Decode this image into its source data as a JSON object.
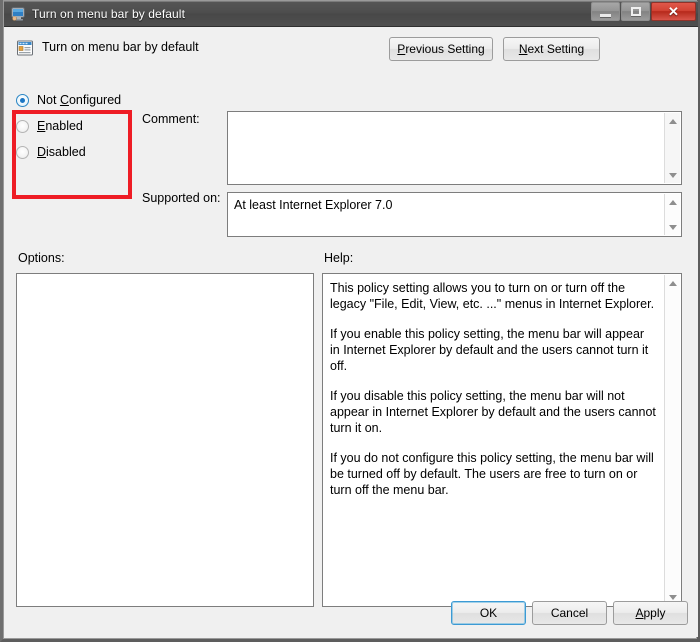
{
  "window": {
    "title": "Turn on menu bar by default",
    "icon": "computer-monitor-icon",
    "controls": {
      "minimize": "minimize-icon",
      "maximize": "maximize-icon",
      "close": "✕"
    }
  },
  "header": {
    "policy_icon": "policy-setting-icon",
    "policy_title": "Turn on menu bar by default",
    "previous_button": {
      "pre": "",
      "acc": "P",
      "post": "revious Setting"
    },
    "next_button": {
      "pre": "",
      "acc": "N",
      "post": "ext Setting"
    }
  },
  "states": {
    "options": [
      {
        "label_pre": "Not ",
        "label_acc": "C",
        "label_post": "onfigured",
        "selected": true
      },
      {
        "label_pre": "",
        "label_acc": "E",
        "label_post": "nabled",
        "selected": false
      },
      {
        "label_pre": "",
        "label_acc": "D",
        "label_post": "isabled",
        "selected": false
      }
    ]
  },
  "annotation": {
    "type": "red-rectangle-highlight",
    "color": "#ee1c25",
    "targets": "state-radio-group"
  },
  "fields": {
    "comment_label": "Comment:",
    "comment_value": "",
    "comment_placeholder": "",
    "supported_label": "Supported on:",
    "supported_value": "At least Internet Explorer 7.0"
  },
  "panels": {
    "options_label": "Options:",
    "options_content": "",
    "help_label": "Help:",
    "help_paragraphs": [
      "This policy setting allows you to turn on or turn off the legacy \"File, Edit, View, etc. ...\" menus in Internet Explorer.",
      "If you enable this policy setting, the menu bar will appear in Internet Explorer by default and the users cannot turn it off.",
      "If you disable this policy setting, the menu bar will not appear in Internet Explorer by default and the users cannot turn it on.",
      "If you do not configure this policy setting, the menu bar will be turned off by default. The users are free to turn on or turn off the menu bar."
    ]
  },
  "footer": {
    "ok_label": "OK",
    "cancel_label": "Cancel",
    "apply": {
      "pre": "",
      "acc": "A",
      "post": "pply"
    }
  }
}
